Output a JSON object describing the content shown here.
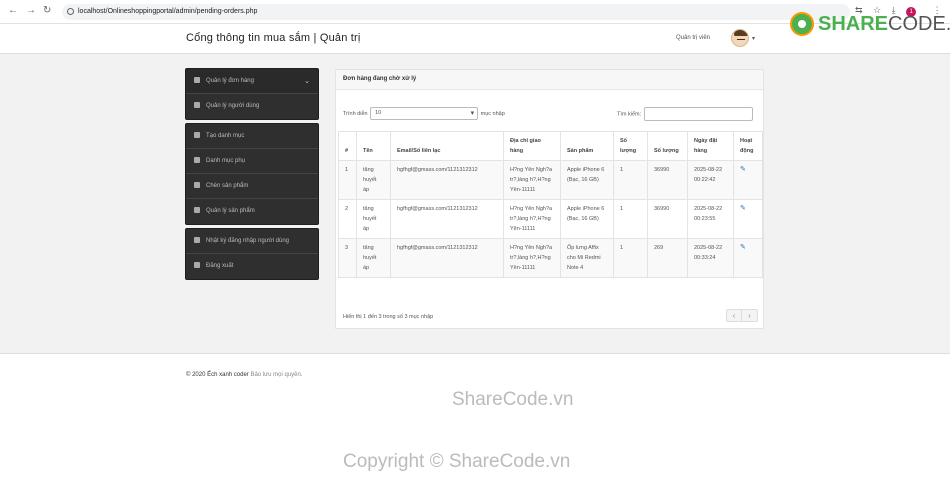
{
  "browser": {
    "url": "localhost/Onlineshoppingportal/admin/pending-orders.php",
    "profile_initial": "1"
  },
  "header": {
    "brand": "Cổng thông tin mua sắm | Quản trị",
    "user_label": "Quản trị viên"
  },
  "logo": {
    "part1": "SHARE",
    "part2": "CODE.vn"
  },
  "sidebar": {
    "group1": [
      {
        "label": "Quản lý đơn hàng",
        "icon": "gear-icon"
      },
      {
        "label": "Quản lý người dùng",
        "icon": "users-icon"
      }
    ],
    "group2": [
      {
        "label": "Tạo danh mục",
        "icon": "list-icon"
      },
      {
        "label": "Danh mục phụ",
        "icon": "list-icon"
      },
      {
        "label": "Chèn sản phẩm",
        "icon": "paste-icon"
      },
      {
        "label": "Quản lý sản phẩm",
        "icon": "table-icon"
      }
    ],
    "group3": [
      {
        "label": "Nhật ký đăng nhập người dùng",
        "icon": "list-icon"
      },
      {
        "label": "Đăng xuất",
        "icon": "signout-icon"
      }
    ]
  },
  "panel": {
    "title": "Đơn hàng đang chờ xử lý",
    "show_prefix": "Trình diễn",
    "show_value": "10",
    "show_suffix": "mục nhập",
    "search_label": "Tìm kiếm:",
    "columns": [
      "#",
      "Tên",
      "Email/Số liên lạc",
      "Địa chỉ giao hàng",
      "Sản phẩm",
      "Số lượng",
      "Số lượng",
      "Ngày đặt hàng",
      "Hoạt động"
    ],
    "rows": [
      {
        "num": "1",
        "name": "tăng huyết áp",
        "email": "hgfhgf@gmass.com/1121312312",
        "address": "H?ng Yên Ngh?a tr?,làng h?,H?ng Yên-11111",
        "product": "Apple iPhone 6 (Bạc, 16 GB)",
        "qty": "1",
        "amount": "36990",
        "date": "2025-08-22 00:22:42"
      },
      {
        "num": "2",
        "name": "tăng huyết áp",
        "email": "hgfhgf@gmass.com/1121312312",
        "address": "H?ng Yên Ngh?a tr?,làng h?,H?ng Yên-11111",
        "product": "Apple iPhone 6 (Bạc, 16 GB)",
        "qty": "1",
        "amount": "36990",
        "date": "2025-08-22 00:23:55"
      },
      {
        "num": "3",
        "name": "tăng huyết áp",
        "email": "hgfhgf@gmass.com/1121312312",
        "address": "H?ng Yên Ngh?a tr?,làng h?,H?ng Yên-11111",
        "product": "Ốp lưng Affix cho Mi Redmi Note 4",
        "qty": "1",
        "amount": "269",
        "date": "2025-08-22 00:33:24"
      }
    ],
    "info": "Hiển thị 1 đến 3 trong số 3 mục nhập"
  },
  "footer": {
    "copyright": "© 2020 Ếch xanh coder",
    "rest": "Bảo lưu mọi quyền."
  },
  "watermark": {
    "line1": "ShareCode.vn",
    "line2": "Copyright © ShareCode.vn"
  }
}
